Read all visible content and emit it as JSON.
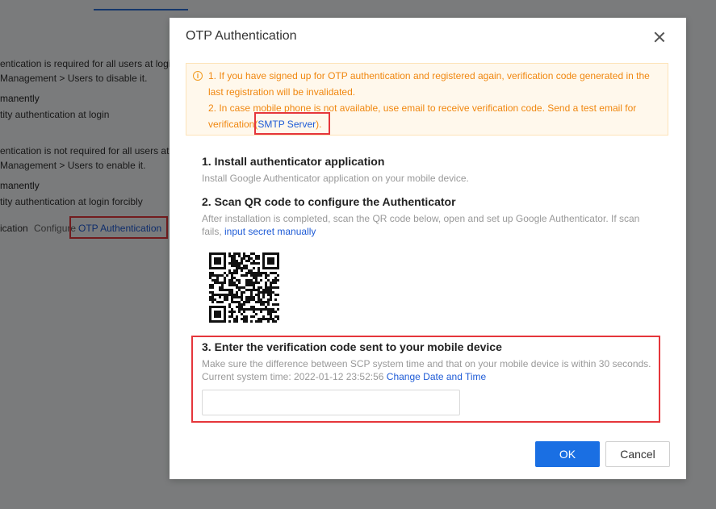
{
  "background": {
    "lines": [
      "entication is required for all users at login",
      "Management > Users to disable it.",
      "manently",
      "tity authentication at login",
      "entication is not required for all users at",
      "Management > Users to enable it.",
      "manently",
      "tity authentication at login forcibly",
      "ication"
    ],
    "configure_label": "Configure",
    "otp_link": "OTP Authentication"
  },
  "dialog": {
    "title": "OTP Authentication",
    "alert": {
      "line1": "1. If you have signed up for OTP authentication and registered again, verification code generated in the",
      "line2": "last registration will be invalidated.",
      "line3": "2. In case mobile phone is not available, use email to receive verification code. Send a test email for",
      "line4_prefix": "verification(",
      "smtp_link": "SMTP Server",
      "line4_suffix": ")."
    },
    "step1": {
      "title": "1. Install authenticator application",
      "desc": "Install Google Authenticator application on your mobile device."
    },
    "step2": {
      "title": "2. Scan QR code to configure the Authenticator",
      "desc_line1": "After installation is completed, scan the QR code below, open and set up Google Authenticator. If scan",
      "desc_line2_prefix": "fails, ",
      "secret_link": "input secret manually"
    },
    "step3": {
      "title": "3. Enter the verification code sent to your mobile device",
      "desc_line1": "Make sure the difference between SCP system time and that on your mobile device is within 30 seconds.",
      "time_prefix": "Current system time: 2022-01-12 23:52:56 ",
      "change_link": "Change Date and Time",
      "input_value": "",
      "input_placeholder": ""
    },
    "buttons": {
      "ok": "OK",
      "cancel": "Cancel"
    }
  },
  "colors": {
    "primary": "#1a6fe3",
    "link": "#1e5bd6",
    "warning_text": "#f0870f",
    "highlight_box": "#e5363b"
  }
}
